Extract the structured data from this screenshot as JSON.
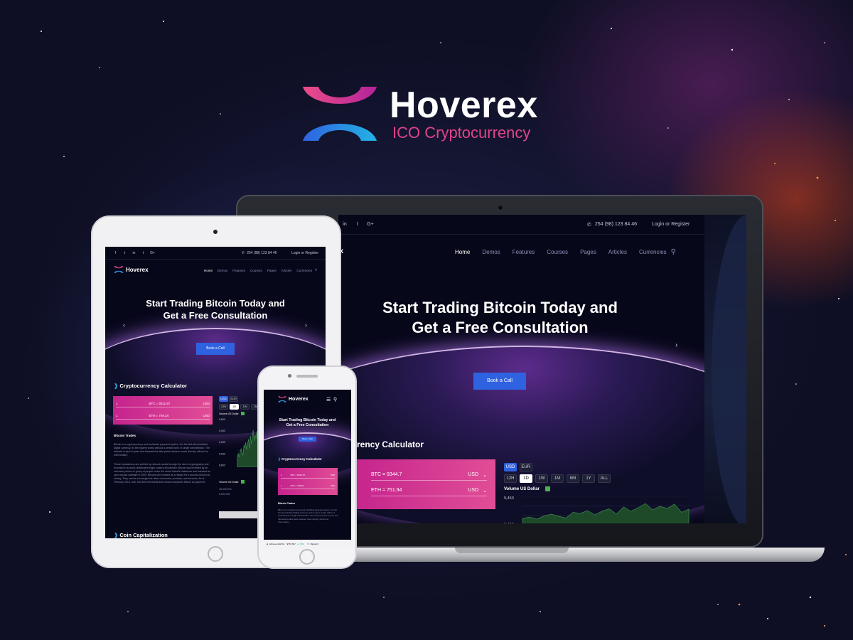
{
  "logo": {
    "name": "Hoverex",
    "tagline": "ICO Cryptocurrency"
  },
  "site": {
    "brand": "Hoverex",
    "phone": "254 (98) 123 84 46",
    "login": "Login",
    "or": "or",
    "register": "Register",
    "socials": [
      "f",
      "t",
      "in",
      "t",
      "G+"
    ],
    "nav": [
      "Home",
      "Demos",
      "Features",
      "Courses",
      "Pages",
      "Articles",
      "Currencies"
    ],
    "hero_line1": "Start Trading Bitcoin Today and",
    "hero_line2": "Get a Free Consultation",
    "hero_button": "Book a Call",
    "calc_title": "Cryptocurrency Calculator",
    "calc_title_cut": "urrency Calculator",
    "calc_rows": [
      {
        "amount": "1",
        "label": "BTC",
        "value": "= 9344.7",
        "currency": "USD"
      },
      {
        "amount": "1",
        "label": "ETH",
        "value": "= 751.94",
        "currency": "USD"
      }
    ],
    "tablet_calc_rows": [
      {
        "amount": "1",
        "label": "BTC",
        "value": "= 9311.57",
        "currency": "USD"
      },
      {
        "amount": "1",
        "label": "ETH",
        "value": "= 749.34",
        "currency": "USD"
      }
    ],
    "phone_calc_rows": [
      {
        "amount": "1",
        "label": "BTC",
        "value": "= 9314.57",
        "currency": "USD"
      },
      {
        "amount": "1",
        "label": "ETH",
        "value": "= 748.04",
        "currency": "USD"
      }
    ],
    "currency_tabs": [
      "USD",
      "EUR"
    ],
    "period_tabs": [
      "12H",
      "1D",
      "1W",
      "1M",
      "6M",
      "1Y",
      "ALL"
    ],
    "tablet_period_tabs": [
      "12H",
      "1D",
      "1W",
      "1M"
    ],
    "volume_label": "Volume US Dollar",
    "volume_short": "Volume US Dollar",
    "y_ticks": [
      "9,450",
      "9,400"
    ],
    "tablet_y_ticks": [
      "9,600",
      "9,400",
      "9,200",
      "9,000",
      "8,800"
    ],
    "tablet_x_ticks": [
      "18:00",
      "18:00"
    ],
    "tablet_vol_ticks": [
      "18,000,000",
      "8,000,000"
    ],
    "trades_title": "Bitcoin Trades",
    "trades_p1": "Bitcoin is a cryptocurrency and worldwide payment system. It is the first decentralized digital currency, as the system works without a central bank or single administrator. The network is peer-to-peer and transactions take place between users directly, without an intermediary.",
    "trades_p2": "These transactions are verified by network nodes through the use of cryptography and recorded in a public distributed ledger called a blockchain. Bitcoin was invented by an unknown person or group of people under the name Satoshi Nakamoto and released as open-source software in 2009. Bitcoins are created as a reward for a process known as mining. They can be exchanged for other currencies, products, and services. As of February 2015, over 100,000 merchants and vendors accepted bitcoin as payment.",
    "phone_trades_p1": "Bitcoin is a cryptocurrency and worldwide payment system. It is the first decentralized digital currency, as the system works without a central bank or single administrator. The network is peer-to-peer and transactions take place between users directly, without an intermediary.",
    "coin_cap_title": "Coin Capitalization",
    "ticker": [
      {
        "name": "Ethereum(ETH)",
        "price": "$756.507",
        "change": "+1.05%"
      },
      {
        "name": "Ripple(X",
        "price": "",
        "change": ""
      }
    ]
  },
  "colors": {
    "brand_pink": "#e0448c",
    "accent_blue": "#2f62e0",
    "calc_gradient_start": "#c4238d",
    "calc_gradient_end": "#e14d96",
    "volume_green": "#4caf50",
    "site_bg": "#07071a"
  },
  "chart_data": {
    "type": "area",
    "title": "",
    "series": [
      {
        "name": "Volume US Dollar",
        "values": [
          9398,
          9402,
          9396,
          9405,
          9410,
          9404,
          9399,
          9415,
          9412,
          9420,
          9408,
          9418,
          9425,
          9410,
          9430,
          9418,
          9428,
          9440,
          9422,
          9432,
          9426,
          9438,
          9415,
          9424
        ]
      }
    ],
    "yticks": [
      9450,
      9400
    ],
    "ylim": [
      9380,
      9460
    ],
    "grid": true
  }
}
